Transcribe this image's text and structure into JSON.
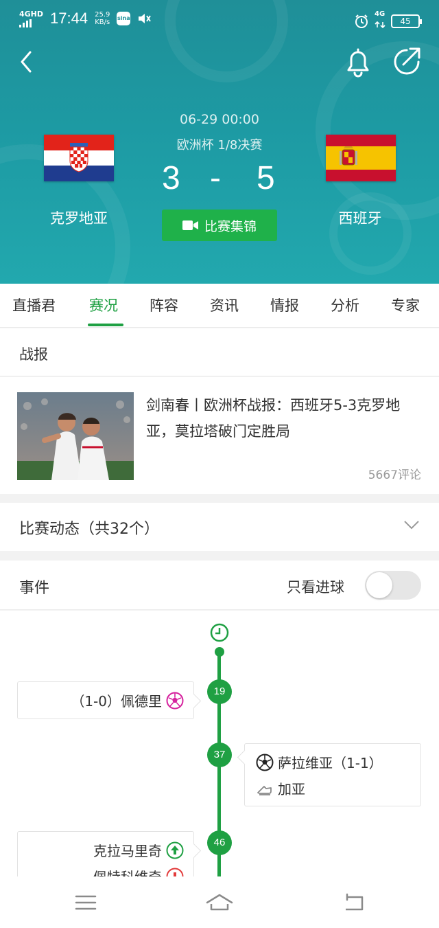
{
  "status_bar": {
    "network": "4GHD",
    "time": "17:44",
    "speed_value": "25.9",
    "speed_unit": "KB/s",
    "app_icon": "sina",
    "right_network": "4G",
    "battery": "45"
  },
  "header": {
    "datetime": "06-29 00:00",
    "competition": "欧洲杯 1/8决赛",
    "home_team": "克罗地亚",
    "away_team": "西班牙",
    "home_score": "3",
    "separator": "-",
    "away_score": "5",
    "highlights_label": "比赛集锦",
    "icons": [
      "back-icon",
      "bell-icon",
      "share-icon",
      "video-camera-icon"
    ]
  },
  "tabs": [
    {
      "label": "直播君",
      "active": false
    },
    {
      "label": "赛况",
      "active": true
    },
    {
      "label": "阵容",
      "active": false
    },
    {
      "label": "资讯",
      "active": false
    },
    {
      "label": "情报",
      "active": false
    },
    {
      "label": "分析",
      "active": false
    },
    {
      "label": "专家",
      "active": false
    }
  ],
  "report": {
    "section_title": "战报",
    "news_title": "剑南春丨欧洲杯战报：西班牙5-3克罗地亚，莫拉塔破门定胜局",
    "comments": "5667评论"
  },
  "dynamics": {
    "title": "比赛动态（共32个）"
  },
  "events": {
    "title": "事件",
    "goals_only_label": "只看进球",
    "goals_only_enabled": false,
    "items": [
      {
        "minute": "19",
        "side": "home",
        "rows": [
          {
            "text": "（1-0）佩德里",
            "icon": "own-goal-ball-icon"
          }
        ]
      },
      {
        "minute": "37",
        "side": "away",
        "rows": [
          {
            "text": "萨拉维亚（1-1）",
            "icon": "football-icon"
          },
          {
            "text": "加亚",
            "icon": "assist-boot-icon"
          }
        ]
      },
      {
        "minute": "46",
        "side": "home",
        "rows": [
          {
            "text": "克拉马里奇",
            "icon": "substitution-in-icon"
          },
          {
            "text": "佩特科维奇",
            "icon": "substitution-out-icon"
          }
        ]
      }
    ]
  },
  "colors": {
    "header_teal": "#1d9aa3",
    "accent_green": "#1fa043",
    "button_green": "#1fb14a"
  }
}
